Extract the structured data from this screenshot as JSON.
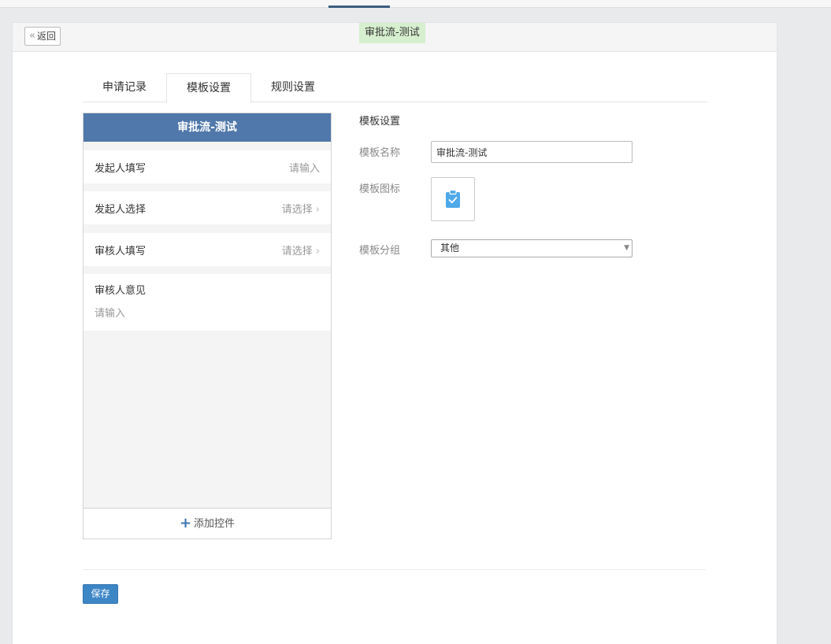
{
  "header": {
    "back_label": "返回",
    "title": "审批流-测试"
  },
  "tabs": [
    {
      "label": "申请记录",
      "active": false
    },
    {
      "label": "模板设置",
      "active": true
    },
    {
      "label": "规则设置",
      "active": false
    }
  ],
  "preview": {
    "title": "审批流-测试",
    "fields": [
      {
        "label": "发起人填写",
        "placeholder": "请输入",
        "has_arrow": false
      },
      {
        "label": "发起人选择",
        "placeholder": "请选择",
        "has_arrow": true
      },
      {
        "label": "审核人填写",
        "placeholder": "请选择",
        "has_arrow": true
      },
      {
        "label": "审核人意见",
        "placeholder": "请输入",
        "has_arrow": false
      }
    ],
    "add_control_label": "添加控件"
  },
  "settings": {
    "title": "模板设置",
    "name_label": "模板名称",
    "name_value": "审批流-测试",
    "icon_label": "模板图标",
    "icon": "clipboard-check-icon",
    "group_label": "模板分组",
    "group_value": "其他"
  },
  "footer": {
    "save_label": "保存"
  },
  "colors": {
    "primary": "#3d86c6",
    "preview_header": "#5078aa",
    "title_highlight": "#d6efce",
    "icon": "#4fa9e9"
  }
}
